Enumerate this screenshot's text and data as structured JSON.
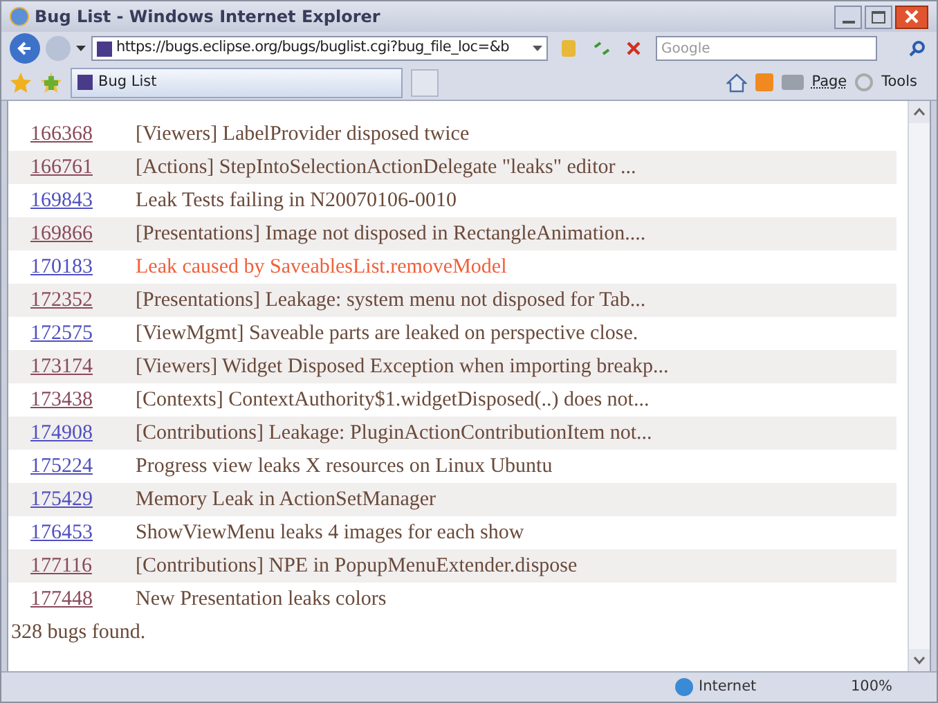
{
  "window": {
    "title": "Bug List - Windows Internet Explorer"
  },
  "address_bar": {
    "url": "https://bugs.eclipse.org/bugs/buglist.cgi?bug_file_loc=&b"
  },
  "search": {
    "placeholder": "Google"
  },
  "tab": {
    "label": "Bug List"
  },
  "command_bar": {
    "page": "Page",
    "tools": "Tools"
  },
  "bugs": [
    {
      "id": "166368",
      "summary": "[Viewers] LabelProvider disposed twice",
      "visited": true,
      "highlighted": false
    },
    {
      "id": "166761",
      "summary": "[Actions] StepIntoSelectionActionDelegate \"leaks\" editor ...",
      "visited": true,
      "highlighted": false
    },
    {
      "id": "169843",
      "summary": "Leak Tests failing in N20070106-0010",
      "visited": false,
      "highlighted": false
    },
    {
      "id": "169866",
      "summary": "[Presentations] Image not disposed in RectangleAnimation....",
      "visited": true,
      "highlighted": false
    },
    {
      "id": "170183",
      "summary": "Leak caused by SaveablesList.removeModel",
      "visited": false,
      "highlighted": true
    },
    {
      "id": "172352",
      "summary": "[Presentations] Leakage: system menu not disposed for Tab...",
      "visited": true,
      "highlighted": false
    },
    {
      "id": "172575",
      "summary": "[ViewMgmt] Saveable parts are leaked on perspective close.",
      "visited": false,
      "highlighted": false
    },
    {
      "id": "173174",
      "summary": "[Viewers] Widget Disposed Exception when importing breakp...",
      "visited": true,
      "highlighted": false
    },
    {
      "id": "173438",
      "summary": "[Contexts] ContextAuthority$1.widgetDisposed(..) does not...",
      "visited": true,
      "highlighted": false
    },
    {
      "id": "174908",
      "summary": "[Contributions] Leakage: PluginActionContributionItem not...",
      "visited": false,
      "highlighted": false
    },
    {
      "id": "175224",
      "summary": "Progress view leaks X resources on Linux Ubuntu",
      "visited": false,
      "highlighted": false
    },
    {
      "id": "175429",
      "summary": "Memory Leak in ActionSetManager",
      "visited": false,
      "highlighted": false
    },
    {
      "id": "176453",
      "summary": "ShowViewMenu leaks 4 images for each show",
      "visited": false,
      "highlighted": false
    },
    {
      "id": "177116",
      "summary": "[Contributions] NPE in PopupMenuExtender.dispose",
      "visited": true,
      "highlighted": false
    },
    {
      "id": "177448",
      "summary": "New Presentation leaks colors",
      "visited": true,
      "highlighted": false
    }
  ],
  "result_count": "328 bugs found.",
  "status_bar": {
    "zone": "Internet",
    "zoom": "100%"
  }
}
